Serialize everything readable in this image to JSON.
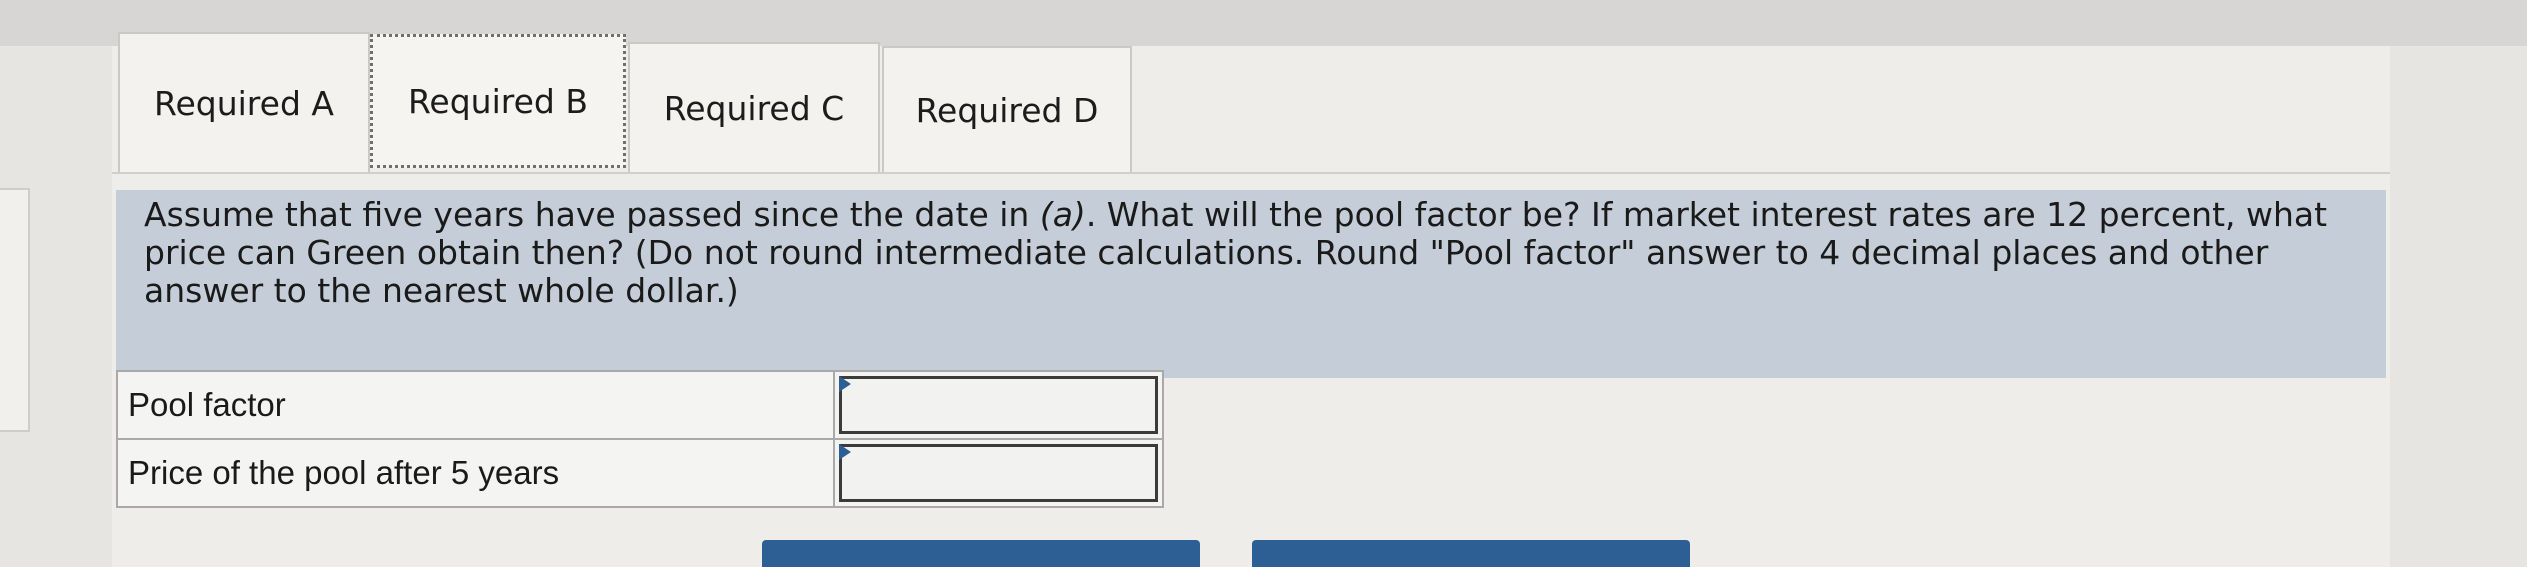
{
  "tabs": [
    {
      "label": "Required A"
    },
    {
      "label": "Required B"
    },
    {
      "label": "Required C"
    },
    {
      "label": "Required D"
    }
  ],
  "question": {
    "part1": "Assume that five years have passed since the date in ",
    "italic": "(a)",
    "part2": ". What will the pool factor be? If market interest rates are 12 percent, what price can Green obtain then? (Do not round intermediate calculations. Round \"Pool factor\" answer to 4 decimal places and other answer to the nearest whole dollar.)"
  },
  "table": {
    "rows": [
      {
        "label": "Pool factor",
        "value": ""
      },
      {
        "label": "Price of the pool after 5 years",
        "value": ""
      }
    ]
  },
  "colors": {
    "accent": "#2e5f94",
    "question_bg": "#c5ced8"
  }
}
